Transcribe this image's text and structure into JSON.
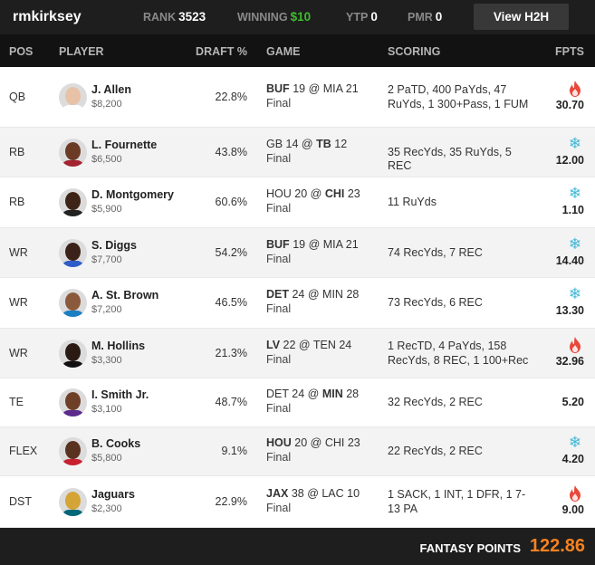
{
  "topbar": {
    "username": "rmkirksey",
    "rank_label": "RANK",
    "rank_value": "3523",
    "winning_label": "WINNING",
    "winning_value": "$10",
    "ytp_label": "YTP",
    "ytp_value": "0",
    "pmr_label": "PMR",
    "pmr_value": "0",
    "h2h_button": "View H2H"
  },
  "columns": {
    "pos": "POS",
    "player": "PLAYER",
    "draft": "DRAFT %",
    "game": "GAME",
    "scoring": "SCORING",
    "fpts": "FPTS"
  },
  "colors": {
    "fire": "#e8483a",
    "ice": "#3fb8d6",
    "total": "#f58220",
    "winning": "#3ebd2e"
  },
  "rows": [
    {
      "pos": "QB",
      "name": "J. Allen",
      "salary": "$8,200",
      "draft": "22.8%",
      "away": "BUF",
      "away_score": "19",
      "home": "MIA",
      "home_score": "21",
      "bold": "away",
      "status": "Final",
      "scoring": "2 PaTD, 400 PaYds, 47 RuYds, 1 300+Pass, 1 FUM",
      "fpts": "30.70",
      "icon": "fire-icon",
      "face": "#e8c2a6",
      "jersey": "#ffffff"
    },
    {
      "pos": "RB",
      "name": "L. Fournette",
      "salary": "$6,500",
      "draft": "43.8%",
      "away": "GB",
      "away_score": "14",
      "home": "TB",
      "home_score": "12",
      "bold": "home",
      "status": "Final",
      "scoring": "35 RecYds, 35 RuYds, 5 REC",
      "fpts": "12.00",
      "icon": "snowflake-icon",
      "face": "#6b3b26",
      "jersey": "#a32430"
    },
    {
      "pos": "RB",
      "name": "D. Montgomery",
      "salary": "$5,900",
      "draft": "60.6%",
      "away": "HOU",
      "away_score": "20",
      "home": "CHI",
      "home_score": "23",
      "bold": "home",
      "status": "Final",
      "scoring": "11 RuYds",
      "fpts": "1.10",
      "icon": "snowflake-icon",
      "face": "#3d2416",
      "jersey": "#222222"
    },
    {
      "pos": "WR",
      "name": "S. Diggs",
      "salary": "$7,700",
      "draft": "54.2%",
      "away": "BUF",
      "away_score": "19",
      "home": "MIA",
      "home_score": "21",
      "bold": "away",
      "status": "Final",
      "scoring": "74 RecYds, 7 REC",
      "fpts": "14.40",
      "icon": "snowflake-icon",
      "face": "#3a2218",
      "jersey": "#2e5cc8"
    },
    {
      "pos": "WR",
      "name": "A. St. Brown",
      "salary": "$7,200",
      "draft": "46.5%",
      "away": "DET",
      "away_score": "24",
      "home": "MIN",
      "home_score": "28",
      "bold": "away",
      "status": "Final",
      "scoring": "73 RecYds, 6 REC",
      "fpts": "13.30",
      "icon": "snowflake-icon",
      "face": "#8b5a3c",
      "jersey": "#1c7fc4"
    },
    {
      "pos": "WR",
      "name": "M. Hollins",
      "salary": "$3,300",
      "draft": "21.3%",
      "away": "LV",
      "away_score": "22",
      "home": "TEN",
      "home_score": "24",
      "bold": "away",
      "status": "Final",
      "scoring": "1 RecTD, 4 PaYds, 158 RecYds, 8 REC, 1 100+Rec",
      "fpts": "32.96",
      "icon": "fire-icon",
      "face": "#2a1a12",
      "jersey": "#111111"
    },
    {
      "pos": "TE",
      "name": "I. Smith Jr.",
      "salary": "$3,100",
      "draft": "48.7%",
      "away": "DET",
      "away_score": "24",
      "home": "MIN",
      "home_score": "28",
      "bold": "home",
      "status": "Final",
      "scoring": "32 RecYds, 2 REC",
      "fpts": "5.20",
      "icon": "",
      "face": "#6e4028",
      "jersey": "#5b2a8c"
    },
    {
      "pos": "FLEX",
      "name": "B. Cooks",
      "salary": "$5,800",
      "draft": "9.1%",
      "away": "HOU",
      "away_score": "20",
      "home": "CHI",
      "home_score": "23",
      "bold": "away",
      "status": "Final",
      "scoring": "22 RecYds, 2 REC",
      "fpts": "4.20",
      "icon": "snowflake-icon",
      "face": "#5a3220",
      "jersey": "#c8202e"
    },
    {
      "pos": "DST",
      "name": "Jaguars",
      "salary": "$2,300",
      "draft": "22.9%",
      "away": "JAX",
      "away_score": "38",
      "home": "LAC",
      "home_score": "10",
      "bold": "away",
      "status": "Final",
      "scoring": "1 SACK, 1 INT, 1 DFR, 1 7-13 PA",
      "fpts": "9.00",
      "icon": "fire-icon",
      "face": "#d4a437",
      "jersey": "#006778"
    }
  ],
  "footer": {
    "label": "FANTASY POINTS",
    "total": "122.86"
  }
}
